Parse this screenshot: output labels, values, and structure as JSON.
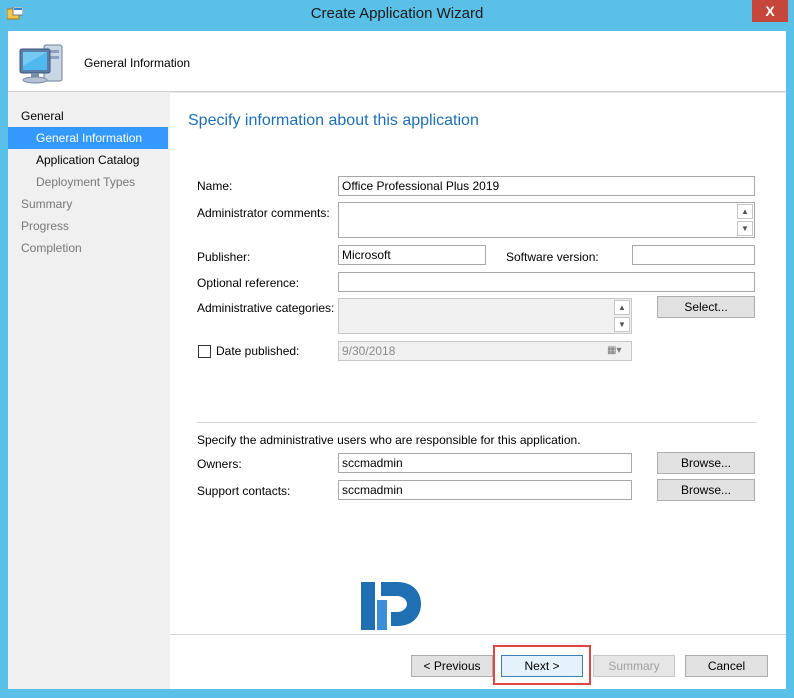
{
  "window": {
    "title": "Create Application Wizard",
    "close_label": "X"
  },
  "header": {
    "title": "General Information"
  },
  "nav": {
    "items": [
      {
        "label": "General",
        "level": 1,
        "state": "normal"
      },
      {
        "label": "General Information",
        "level": 2,
        "state": "selected"
      },
      {
        "label": "Application Catalog",
        "level": 2,
        "state": "normal"
      },
      {
        "label": "Deployment Types",
        "level": 2,
        "state": "dim"
      },
      {
        "label": "Summary",
        "level": 1,
        "state": "dim"
      },
      {
        "label": "Progress",
        "level": 1,
        "state": "dim"
      },
      {
        "label": "Completion",
        "level": 1,
        "state": "dim"
      }
    ]
  },
  "form": {
    "heading": "Specify information about this application",
    "name_label": "Name:",
    "name_value": "Office Professional Plus 2019",
    "admin_comments_label": "Administrator comments:",
    "admin_comments_value": "",
    "publisher_label": "Publisher:",
    "publisher_value": "Microsoft",
    "software_version_label": "Software version:",
    "software_version_value": "",
    "optional_reference_label": "Optional reference:",
    "optional_reference_value": "",
    "admin_categories_label": "Administrative categories:",
    "select_button": "Select...",
    "date_published_label": "Date published:",
    "date_published_value": "9/30/2018",
    "date_published_checked": false,
    "responsible_text": "Specify the administrative users who are responsible for this application.",
    "owners_label": "Owners:",
    "owners_value": "sccmadmin",
    "support_contacts_label": "Support contacts:",
    "support_contacts_value": "sccmadmin",
    "browse_button": "Browse..."
  },
  "footer": {
    "previous": "< Previous",
    "next": "Next >",
    "summary": "Summary",
    "cancel": "Cancel"
  },
  "colors": {
    "titlebar": "#5bc0e8",
    "selection": "#3399ff",
    "heading": "#1e6fb8",
    "close": "#c7463b",
    "highlight": "#e24545"
  }
}
